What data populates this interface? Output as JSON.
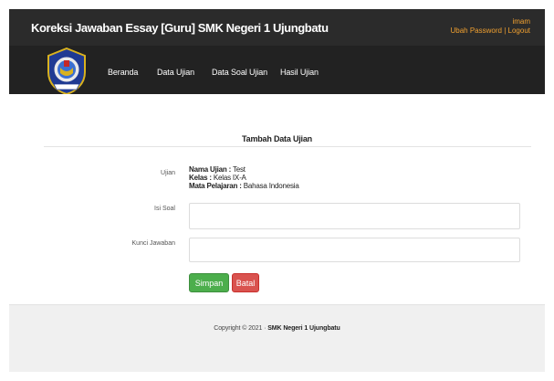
{
  "header": {
    "title": "Koreksi Jawaban Essay [Guru] SMK Negeri 1 Ujungbatu",
    "username": "imam",
    "change_password": "Ubah Password",
    "separator": "|",
    "logout": "Logout"
  },
  "nav": {
    "items": [
      {
        "label": "Beranda"
      },
      {
        "label": "Data Ujian"
      },
      {
        "label": "Data Soal Ujian"
      },
      {
        "label": "Hasil Ujian"
      }
    ]
  },
  "form": {
    "title": "Tambah Data Ujian",
    "ujian_label": "Ujian",
    "nama_ujian_key": "Nama Ujian :",
    "nama_ujian_value": "Test",
    "kelas_key": "Kelas :",
    "kelas_value": "Kelas IX-A",
    "mapel_key": "Mata Pelajaran :",
    "mapel_value": "Bahasa Indonesia",
    "isi_soal_label": "Isi Soal",
    "isi_soal_value": "",
    "kunci_jawaban_label": "Kunci Jawaban",
    "kunci_jawaban_value": "",
    "save_button": "Simpan",
    "cancel_button": "Batal"
  },
  "footer": {
    "copyright": "Copyright © 2021 ·",
    "school": "SMK Negeri 1 Ujungbatu"
  },
  "colors": {
    "topbar": "#2b2b2b",
    "navbar": "#222222",
    "accent_link": "#f0a030",
    "save": "#4cae4c",
    "cancel": "#d9534f"
  },
  "icons": {
    "logo": "school-emblem-icon"
  }
}
